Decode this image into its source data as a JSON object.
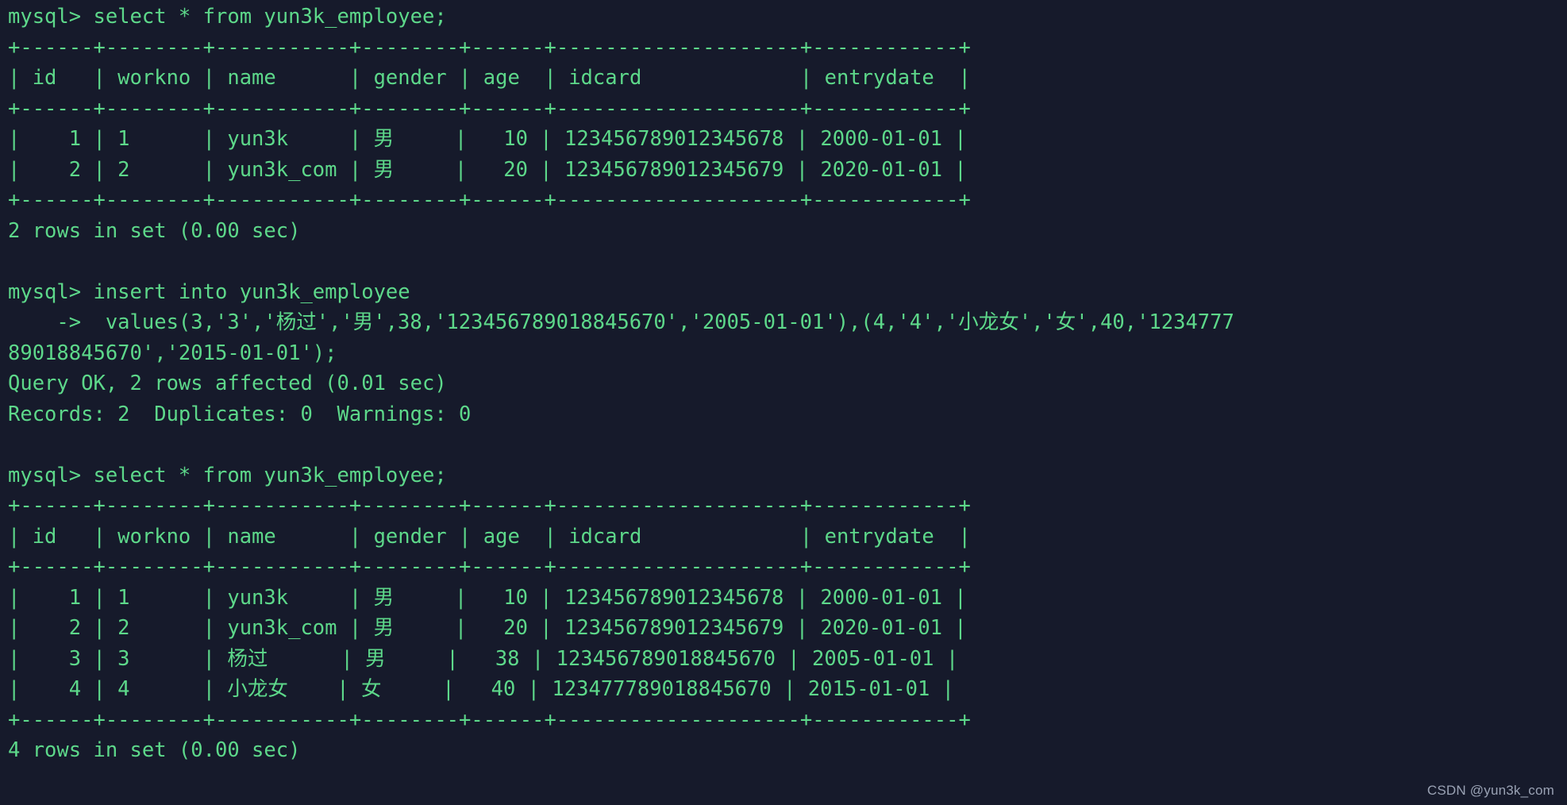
{
  "terminal": {
    "background_color": "#161a2b",
    "text_color": "#5dd88a",
    "watermark_color": "#9aa2b4",
    "watermark": "CSDN @yun3k_com",
    "lines": [
      "mysql> select * from yun3k_employee;",
      "+------+--------+-----------+--------+------+--------------------+------------+",
      "| id   | workno | name      | gender | age  | idcard             | entrydate  |",
      "+------+--------+-----------+--------+------+--------------------+------------+",
      "|    1 | 1      | yun3k     | 男     |   10 | 123456789012345678 | 2000-01-01 |",
      "|    2 | 2      | yun3k_com | 男     |   20 | 123456789012345679 | 2020-01-01 |",
      "+------+--------+-----------+--------+------+--------------------+------------+",
      "2 rows in set (0.00 sec)",
      "",
      "mysql> insert into yun3k_employee",
      "    ->  values(3,'3','杨过','男',38,'123456789018845670','2005-01-01'),(4,'4','小龙女','女',40,'1234777",
      "89018845670','2015-01-01');",
      "Query OK, 2 rows affected (0.01 sec)",
      "Records: 2  Duplicates: 0  Warnings: 0",
      "",
      "mysql> select * from yun3k_employee;",
      "+------+--------+-----------+--------+------+--------------------+------------+",
      "| id   | workno | name      | gender | age  | idcard             | entrydate  |",
      "+------+--------+-----------+--------+------+--------------------+------------+",
      "|    1 | 1      | yun3k     | 男     |   10 | 123456789012345678 | 2000-01-01 |",
      "|    2 | 2      | yun3k_com | 男     |   20 | 123456789012345679 | 2020-01-01 |",
      "|    3 | 3      | 杨过      | 男     |   38 | 123456789018845670 | 2005-01-01 |",
      "|    4 | 4      | 小龙女    | 女     |   40 | 123477789018845670 | 2015-01-01 |",
      "+------+--------+-----------+--------+------+--------------------+------------+",
      "4 rows in set (0.00 sec)"
    ],
    "queries": [
      {
        "prompt": "mysql>",
        "sql": "select * from yun3k_employee;",
        "result_status": "2 rows in set (0.00 sec)"
      },
      {
        "prompt": "mysql>",
        "sql": "insert into yun3k_employee",
        "continuation_prompt": "->",
        "continuation_sql": " values(3,'3','杨过','男',38,'123456789018845670','2005-01-01'),(4,'4','小龙女','女',40,'123477789018845670','2015-01-01');",
        "result_status": "Query OK, 2 rows affected (0.01 sec)",
        "result_detail": "Records: 2  Duplicates: 0  Warnings: 0"
      },
      {
        "prompt": "mysql>",
        "sql": "select * from yun3k_employee;",
        "result_status": "4 rows in set (0.00 sec)"
      }
    ],
    "table": {
      "columns": [
        "id",
        "workno",
        "name",
        "gender",
        "age",
        "idcard",
        "entrydate"
      ],
      "rows_before": [
        [
          "1",
          "1",
          "yun3k",
          "男",
          "10",
          "123456789012345678",
          "2000-01-01"
        ],
        [
          "2",
          "2",
          "yun3k_com",
          "男",
          "20",
          "123456789012345679",
          "2020-01-01"
        ]
      ],
      "rows_after": [
        [
          "1",
          "1",
          "yun3k",
          "男",
          "10",
          "123456789012345678",
          "2000-01-01"
        ],
        [
          "2",
          "2",
          "yun3k_com",
          "男",
          "20",
          "123456789012345679",
          "2020-01-01"
        ],
        [
          "3",
          "3",
          "杨过",
          "男",
          "38",
          "123456789018845670",
          "2005-01-01"
        ],
        [
          "4",
          "4",
          "小龙女",
          "女",
          "40",
          "123477789018845670",
          "2015-01-01"
        ]
      ]
    }
  }
}
